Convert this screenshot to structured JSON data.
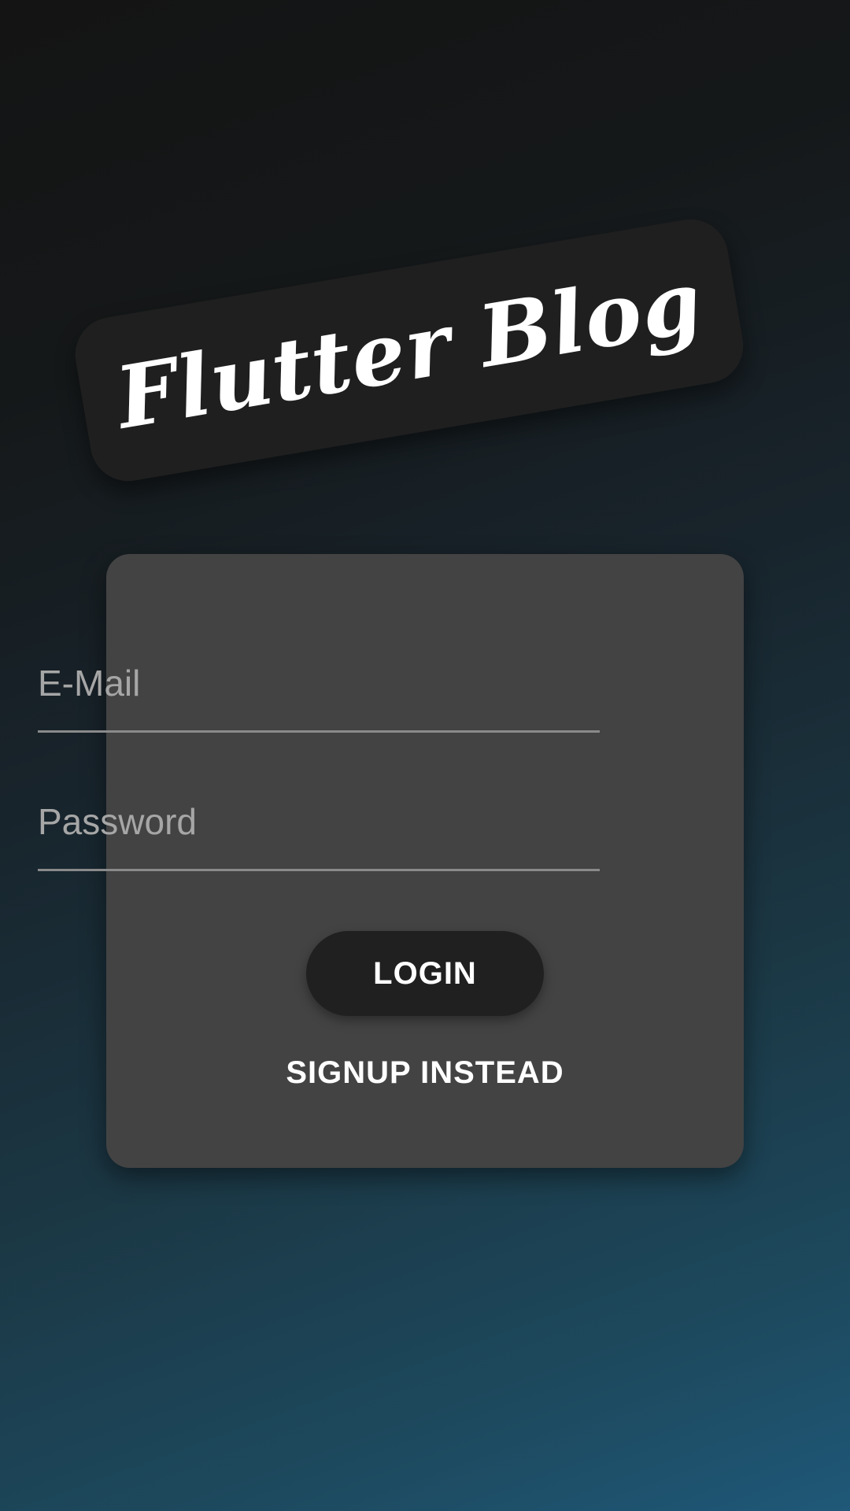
{
  "app": {
    "title": "Flutter Blog"
  },
  "login_form": {
    "email": {
      "value": "",
      "placeholder": "E-Mail"
    },
    "password": {
      "value": "",
      "placeholder": "Password"
    },
    "login_label": "LOGIN",
    "switch_mode_label": "SIGNUP INSTEAD"
  },
  "colors": {
    "background_top": "#141414",
    "background_bottom": "#1f5878",
    "logo_banner": "#1f1f1f",
    "card": "#434343",
    "primary_button": "#202020",
    "text_primary": "#ffffff",
    "placeholder": "#a6a6a6",
    "underline": "#8a8a8a"
  }
}
